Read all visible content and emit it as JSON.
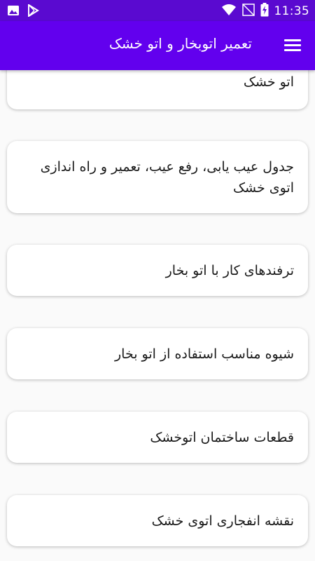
{
  "status_bar": {
    "time": "11:35",
    "left_icons": [
      "image-icon",
      "play-store-icon"
    ],
    "right_icons": [
      "wifi-icon",
      "no-signal-icon",
      "battery-charging-icon"
    ]
  },
  "app_bar": {
    "title": "تعمیر اتوبخار و اتو خشک",
    "menu_icon": "menu-icon"
  },
  "items": [
    {
      "label": "اتو خشک"
    },
    {
      "label": "جدول عیب یابی، رفع عیب، تعمیر و راه اندازی اتوی خشک"
    },
    {
      "label": "ترفندهای کار با اتو بخار"
    },
    {
      "label": "شیوه مناسب استفاده از اتو بخار"
    },
    {
      "label": "قطعات ساختمان اتوخشک"
    },
    {
      "label": "نقشه انفجاری اتوی خشک"
    }
  ],
  "colors": {
    "status_bar": "#5a0ad0",
    "app_bar": "#6200ee",
    "background": "#fafafa",
    "card": "#ffffff"
  }
}
